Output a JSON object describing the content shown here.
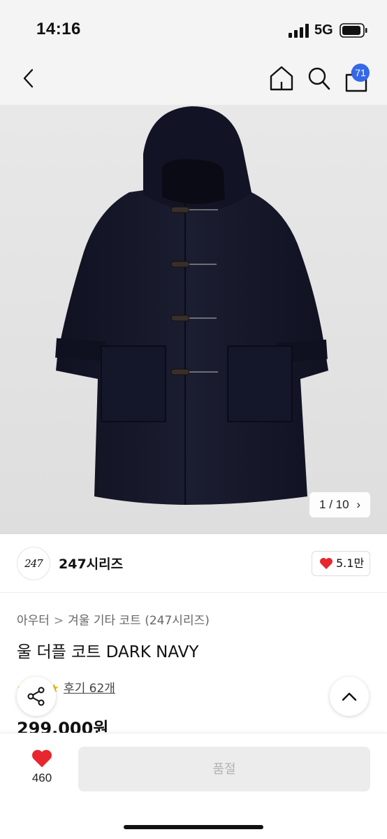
{
  "status_bar": {
    "time": "14:16",
    "network": "5G"
  },
  "header": {
    "icons": [
      "back-icon",
      "home-icon",
      "search-icon",
      "cart-icon"
    ],
    "cart_badge": "71"
  },
  "gallery": {
    "counter": "1 / 10",
    "next_icon": "chevron-right-icon"
  },
  "brand": {
    "logo_text": "247",
    "name": "247시리즈",
    "likes": "5.1만"
  },
  "breadcrumb": {
    "items": [
      "아우터",
      "겨울 기타 코트 (247시리즈)"
    ],
    "separator": ">"
  },
  "product": {
    "title": "울 더플 코트 DARK NAVY",
    "review_label": "후기 62개",
    "price": "299,000원"
  },
  "bottom_bar": {
    "wish_count": "460",
    "buy_label": "품절"
  },
  "colors": {
    "accent": "#3568e9",
    "heart": "#e8262d",
    "coat": "#16182a"
  }
}
